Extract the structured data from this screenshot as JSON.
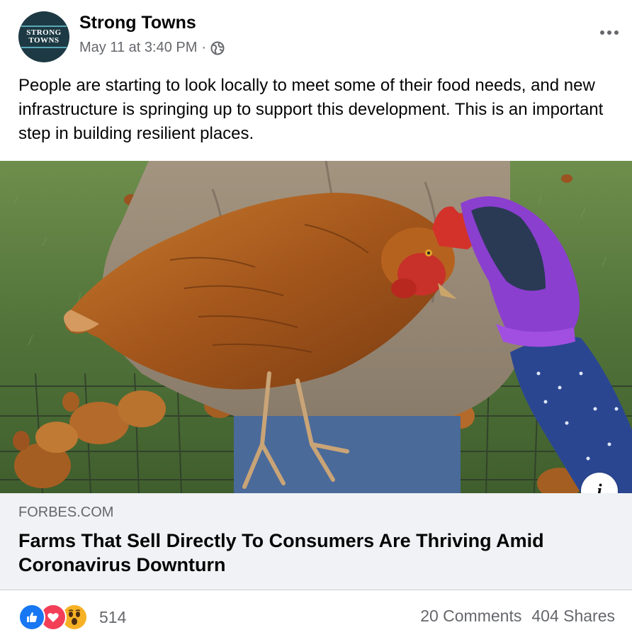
{
  "header": {
    "page_name": "Strong Towns",
    "avatar_logo": "STRONG TOWNS",
    "timestamp": "May 11 at 3:40 PM",
    "separator": "·",
    "audience_icon": "globe-icon",
    "more_icon": "more-options-icon"
  },
  "post": {
    "text": "People are starting to look locally to meet some of their food needs, and new infrastructure is springing up to support this development. This is an important step in building resilient places."
  },
  "link": {
    "image_subject": "person holding a chicken next to a child in a purple mitten, hens on grass behind a wire fence",
    "info_label": "i",
    "domain": "FORBES.COM",
    "title": "Farms That Sell Directly To Consumers Are Thriving Amid Coronavirus Downturn"
  },
  "footer": {
    "reactions": [
      "like-icon",
      "love-icon",
      "wow-icon"
    ],
    "reaction_count": "514",
    "comments": "20 Comments",
    "shares": "404 Shares"
  },
  "colors": {
    "brand_blue": "#1877f2",
    "love_red": "#f33e58",
    "wow_yellow": "#f7b125",
    "secondary_text": "#65676b",
    "link_bg": "#f0f2f5",
    "avatar_bg": "#1d3a44"
  }
}
